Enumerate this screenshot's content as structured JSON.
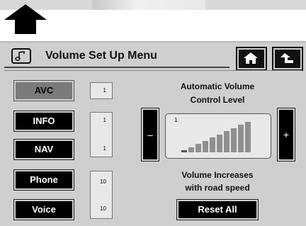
{
  "title": "Volume Set Up Menu",
  "buttons": {
    "avc": "AVC",
    "info": "INFO",
    "nav": "NAV",
    "phone": "Phone",
    "voice": "Voice",
    "reset": "Reset All",
    "decrease": "–",
    "increase": "+"
  },
  "values": {
    "avc": "1",
    "info": "1",
    "nav": "1",
    "phone": "10",
    "voice": "10"
  },
  "avc_section": {
    "heading_line1": "Automatic Volume",
    "heading_line2": "Control Level",
    "level": "1",
    "level_fraction": 0.1
  },
  "speed_note": {
    "line1": "Volume Increases",
    "line2": "with road speed"
  },
  "icons": {
    "title": "music-note-icon",
    "home": "home-icon",
    "back": "back-arrow-icon",
    "pointer": "up-arrow-icon"
  },
  "colors": {
    "screen_bg": "#cfcfcf",
    "button_bg": "#000000",
    "active_button_bg": "#7a7a7a"
  }
}
